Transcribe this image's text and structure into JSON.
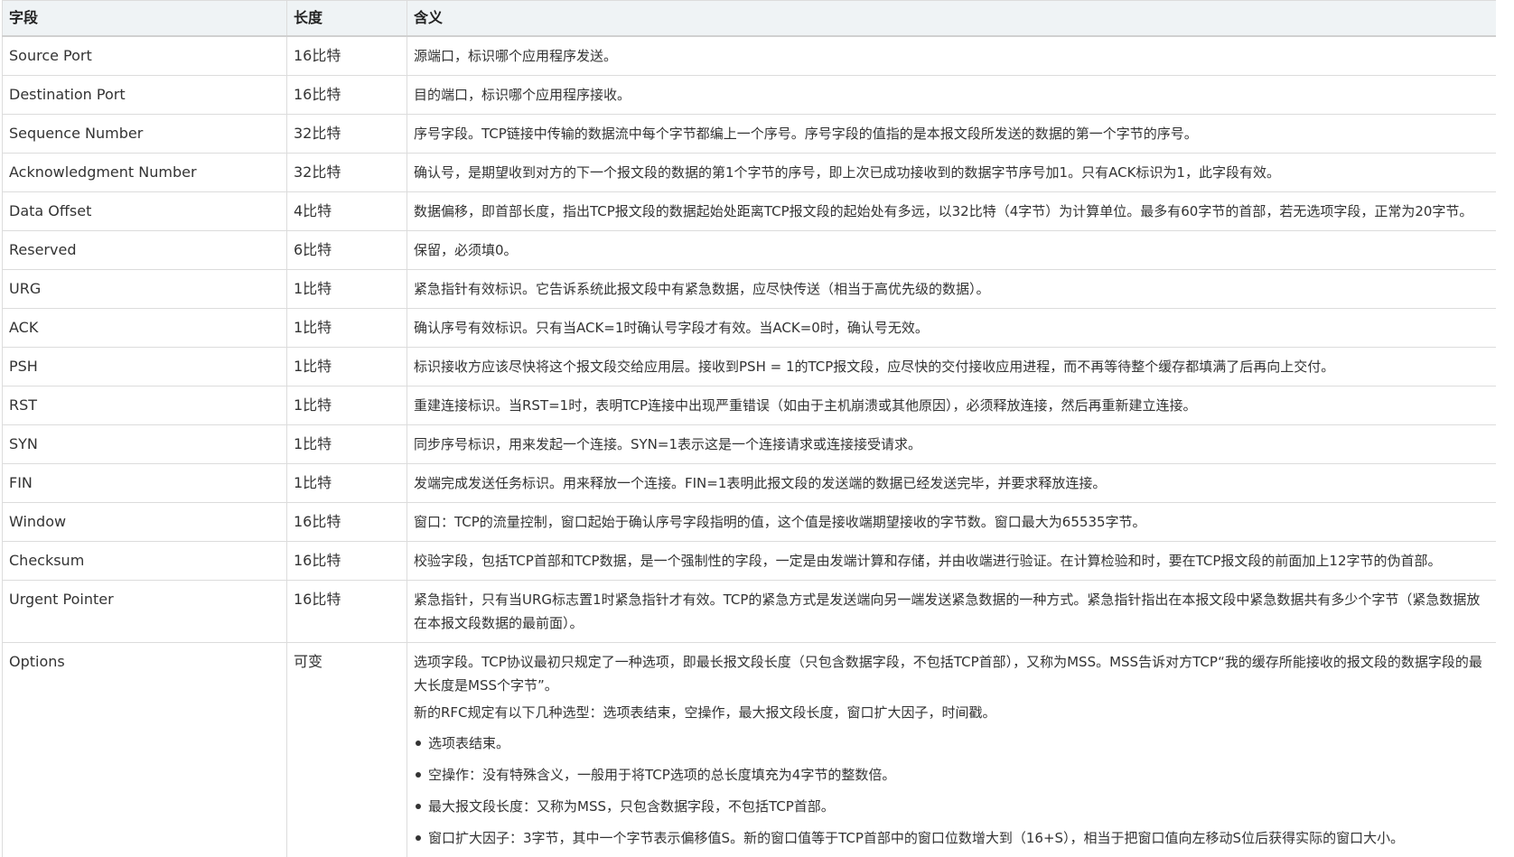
{
  "headers": {
    "field": "字段",
    "length": "长度",
    "meaning": "含义"
  },
  "rows": [
    {
      "field": "Source Port",
      "length": "16比特",
      "meaning": "源端口，标识哪个应用程序发送。"
    },
    {
      "field": "Destination Port",
      "length": "16比特",
      "meaning": "目的端口，标识哪个应用程序接收。"
    },
    {
      "field": "Sequence Number",
      "length": "32比特",
      "meaning": "序号字段。TCP链接中传输的数据流中每个字节都编上一个序号。序号字段的值指的是本报文段所发送的数据的第一个字节的序号。"
    },
    {
      "field": "Acknowledgment Number",
      "length": "32比特",
      "meaning": "确认号，是期望收到对方的下一个报文段的数据的第1个字节的序号，即上次已成功接收到的数据字节序号加1。只有ACK标识为1，此字段有效。"
    },
    {
      "field": "Data Offset",
      "length": "4比特",
      "meaning": "数据偏移，即首部长度，指出TCP报文段的数据起始处距离TCP报文段的起始处有多远，以32比特（4字节）为计算单位。最多有60字节的首部，若无选项字段，正常为20字节。"
    },
    {
      "field": "Reserved",
      "length": "6比特",
      "meaning": "保留，必须填0。"
    },
    {
      "field": "URG",
      "length": "1比特",
      "meaning": "紧急指针有效标识。它告诉系统此报文段中有紧急数据，应尽快传送（相当于高优先级的数据）。"
    },
    {
      "field": "ACK",
      "length": "1比特",
      "meaning": "确认序号有效标识。只有当ACK=1时确认号字段才有效。当ACK=0时，确认号无效。"
    },
    {
      "field": "PSH",
      "length": "1比特",
      "meaning": "标识接收方应该尽快将这个报文段交给应用层。接收到PSH = 1的TCP报文段，应尽快的交付接收应用进程，而不再等待整个缓存都填满了后再向上交付。"
    },
    {
      "field": "RST",
      "length": "1比特",
      "meaning": "重建连接标识。当RST=1时，表明TCP连接中出现严重错误（如由于主机崩溃或其他原因），必须释放连接，然后再重新建立连接。"
    },
    {
      "field": "SYN",
      "length": "1比特",
      "meaning": "同步序号标识，用来发起一个连接。SYN=1表示这是一个连接请求或连接接受请求。"
    },
    {
      "field": "FIN",
      "length": "1比特",
      "meaning": "发端完成发送任务标识。用来释放一个连接。FIN=1表明此报文段的发送端的数据已经发送完毕，并要求释放连接。"
    },
    {
      "field": "Window",
      "length": "16比特",
      "meaning": "窗口：TCP的流量控制，窗口起始于确认序号字段指明的值，这个值是接收端期望接收的字节数。窗口最大为65535字节。"
    },
    {
      "field": "Checksum",
      "length": "16比特",
      "meaning": "校验字段，包括TCP首部和TCP数据，是一个强制性的字段，一定是由发端计算和存储，并由收端进行验证。在计算检验和时，要在TCP报文段的前面加上12字节的伪首部。"
    },
    {
      "field": "Urgent Pointer",
      "length": "16比特",
      "meaning": "紧急指针，只有当URG标志置1时紧急指针才有效。TCP的紧急方式是发送端向另一端发送紧急数据的一种方式。紧急指针指出在本报文段中紧急数据共有多少个字节（紧急数据放在本报文段数据的最前面）。"
    }
  ],
  "options": {
    "field": "Options",
    "length": "可变",
    "para1": "选项字段。TCP协议最初只规定了一种选项，即最长报文段长度（只包含数据字段，不包括TCP首部），又称为MSS。MSS告诉对方TCP“我的缓存所能接收的报文段的数据字段的最大长度是MSS个字节”。",
    "para2": "新的RFC规定有以下几种选型：选项表结束，空操作，最大报文段长度，窗口扩大因子，时间戳。",
    "items": [
      "选项表结束。",
      "空操作：没有特殊含义，一般用于将TCP选项的总长度填充为4字节的整数倍。",
      "最大报文段长度：又称为MSS，只包含数据字段，不包括TCP首部。",
      "窗口扩大因子：3字节，其中一个字节表示偏移值S。新的窗口值等于TCP首部中的窗口位数增大到（16+S），相当于把窗口值向左移动S位后获得实际的窗口大小。"
    ]
  }
}
